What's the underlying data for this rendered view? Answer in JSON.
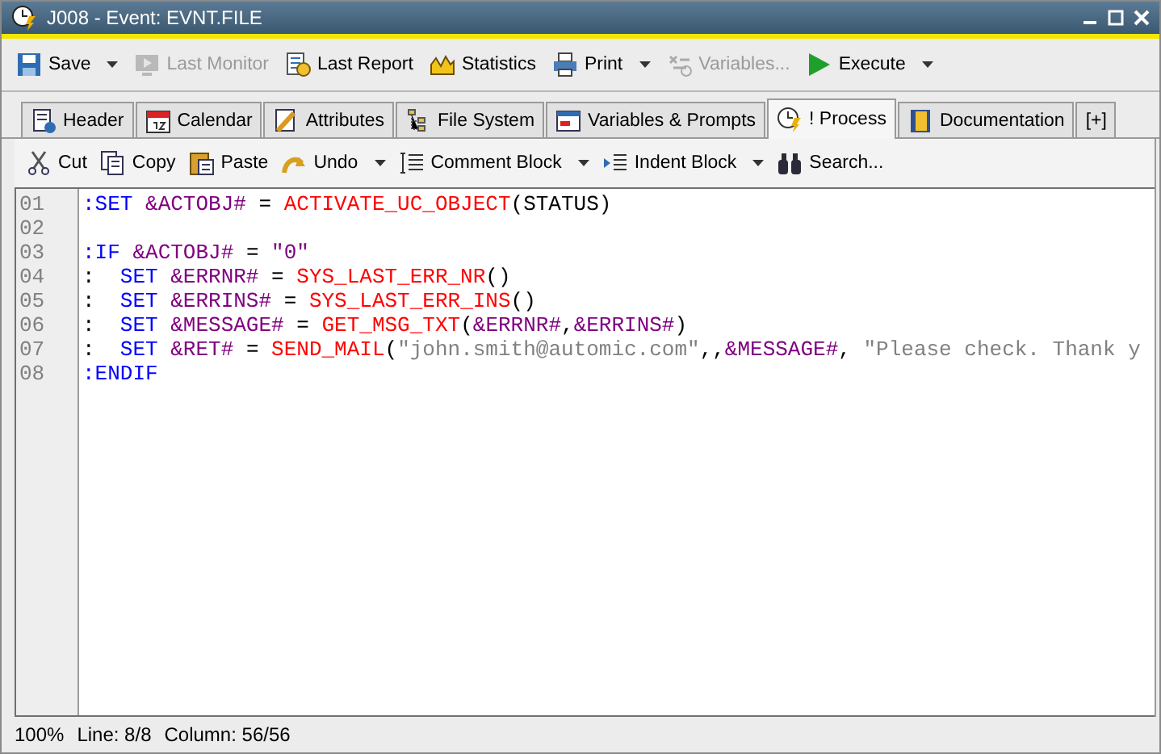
{
  "window": {
    "title": "J008 - Event: EVNT.FILE"
  },
  "toolbar": [
    {
      "label": "Save",
      "disabled": false,
      "dropdown": true
    },
    {
      "label": "Last Monitor",
      "disabled": true,
      "dropdown": false
    },
    {
      "label": "Last Report",
      "disabled": false,
      "dropdown": false
    },
    {
      "label": "Statistics",
      "disabled": false,
      "dropdown": false
    },
    {
      "label": "Print",
      "disabled": false,
      "dropdown": true
    },
    {
      "label": "Variables...",
      "disabled": true,
      "dropdown": false
    },
    {
      "label": "Execute",
      "disabled": false,
      "dropdown": true
    }
  ],
  "tabs": [
    {
      "label": "Header",
      "selected": false
    },
    {
      "label": "Calendar",
      "selected": false
    },
    {
      "label": "Attributes",
      "selected": false
    },
    {
      "label": "File System",
      "selected": false
    },
    {
      "label": "Variables & Prompts",
      "selected": false
    },
    {
      "label": "! Process",
      "selected": true
    },
    {
      "label": "Documentation",
      "selected": false
    },
    {
      "label": "[+]",
      "selected": false
    }
  ],
  "editor_toolbar": [
    {
      "label": "Cut",
      "dropdown": false
    },
    {
      "label": "Copy",
      "dropdown": false
    },
    {
      "label": "Paste",
      "dropdown": false
    },
    {
      "label": "Undo",
      "dropdown": true
    },
    {
      "label": "Comment Block",
      "dropdown": true
    },
    {
      "label": "Indent Block",
      "dropdown": true
    },
    {
      "label": "Search...",
      "dropdown": false
    }
  ],
  "editor": {
    "lines": [
      {
        "number": "01",
        "tokens": [
          {
            "kind": "keyword",
            "text": ":SET "
          },
          {
            "kind": "variable",
            "text": "&ACTOBJ#"
          },
          {
            "kind": "plain",
            "text": " = "
          },
          {
            "kind": "function",
            "text": "ACTIVATE_UC_OBJECT"
          },
          {
            "kind": "plain",
            "text": "(STATUS)"
          }
        ]
      },
      {
        "number": "02"
      },
      {
        "number": "03",
        "tokens": [
          {
            "kind": "keyword",
            "text": ":IF "
          },
          {
            "kind": "variable",
            "text": "&ACTOBJ#"
          },
          {
            "kind": "plain",
            "text": " = "
          },
          {
            "kind": "variable",
            "text": "\"0\""
          }
        ]
      },
      {
        "number": "04",
        "tokens": [
          {
            "kind": "plain",
            "text": ":  "
          },
          {
            "kind": "keyword",
            "text": "SET "
          },
          {
            "kind": "variable",
            "text": "&ERRNR#"
          },
          {
            "kind": "plain",
            "text": " = "
          },
          {
            "kind": "function",
            "text": "SYS_LAST_ERR_NR"
          },
          {
            "kind": "plain",
            "text": "()"
          }
        ]
      },
      {
        "number": "05",
        "tokens": [
          {
            "kind": "plain",
            "text": ":  "
          },
          {
            "kind": "keyword",
            "text": "SET "
          },
          {
            "kind": "variable",
            "text": "&ERRINS#"
          },
          {
            "kind": "plain",
            "text": " = "
          },
          {
            "kind": "function",
            "text": "SYS_LAST_ERR_INS"
          },
          {
            "kind": "plain",
            "text": "()"
          }
        ]
      },
      {
        "number": "06",
        "tokens": [
          {
            "kind": "plain",
            "text": ":  "
          },
          {
            "kind": "keyword",
            "text": "SET "
          },
          {
            "kind": "variable",
            "text": "&MESSAGE#"
          },
          {
            "kind": "plain",
            "text": " = "
          },
          {
            "kind": "function",
            "text": "GET_MSG_TXT"
          },
          {
            "kind": "plain",
            "text": "("
          },
          {
            "kind": "variable",
            "text": "&ERRNR#"
          },
          {
            "kind": "plain",
            "text": ","
          },
          {
            "kind": "variable",
            "text": "&ERRINS#"
          },
          {
            "kind": "plain",
            "text": ")"
          }
        ]
      },
      {
        "number": "07",
        "tokens": [
          {
            "kind": "plain",
            "text": ":  "
          },
          {
            "kind": "keyword",
            "text": "SET "
          },
          {
            "kind": "variable",
            "text": "&RET#"
          },
          {
            "kind": "plain",
            "text": " = "
          },
          {
            "kind": "function",
            "text": "SEND_MAIL"
          },
          {
            "kind": "plain",
            "text": "("
          },
          {
            "kind": "string",
            "text": "\"john.smith@automic.com\""
          },
          {
            "kind": "plain",
            "text": ",,"
          },
          {
            "kind": "variable",
            "text": "&MESSAGE#"
          },
          {
            "kind": "plain",
            "text": ", "
          },
          {
            "kind": "string",
            "text": "\"Please check. Thank y"
          }
        ]
      },
      {
        "number": "08",
        "tokens": [
          {
            "kind": "keyword",
            "text": ":ENDIF"
          }
        ]
      }
    ]
  },
  "status_bar": {
    "zoom": "100%",
    "line": "Line: 8/8",
    "column": "Column: 56/56"
  }
}
